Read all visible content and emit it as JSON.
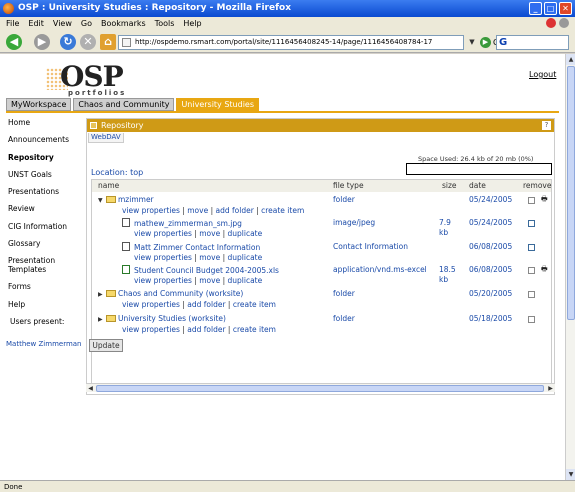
{
  "window": {
    "title": "OSP : University Studies : Repository - Mozilla Firefox"
  },
  "menu": [
    "File",
    "Edit",
    "View",
    "Go",
    "Bookmarks",
    "Tools",
    "Help"
  ],
  "toolbar": {
    "url": "http://ospdemo.rsmart.com/portal/site/1116456408245-14/page/1116456408784-17",
    "go_label": "Go",
    "search_value": "G"
  },
  "header": {
    "logo": "OSP",
    "logo_sub": "portfolios",
    "logout": "Logout"
  },
  "tabs": [
    {
      "label": "MyWorkspace"
    },
    {
      "label": "Chaos and Community"
    },
    {
      "label": "University Studies",
      "active": true
    }
  ],
  "sidebar": {
    "items": [
      {
        "label": "Home"
      },
      {
        "label": "Announcements"
      },
      {
        "label": "Repository",
        "current": true
      },
      {
        "label": "UNST Goals"
      },
      {
        "label": "Presentations"
      },
      {
        "label": "Review"
      },
      {
        "label": "CIG Information"
      },
      {
        "label": "Glossary"
      },
      {
        "label": "Presentation Templates"
      },
      {
        "label": "Forms"
      },
      {
        "label": "Help"
      }
    ],
    "users_present": "Users present:",
    "user": "Matthew Zimmerman"
  },
  "portlet": {
    "title": "Repository",
    "webdav": "WebDAV",
    "space_used": "Space Used: 26.4 kb of 20 mb  (0%)",
    "location_label": "Location:",
    "location_value": "top",
    "columns": {
      "name": "name",
      "type": "file type",
      "size": "size",
      "date": "date",
      "remove": "remove"
    },
    "rows": [
      {
        "name": "mzimmer",
        "actions": [
          "view properties",
          "move",
          "add folder",
          "create item"
        ],
        "type": "folder",
        "size": "",
        "date": "05/24/2005"
      },
      {
        "name": "mathew_zimmerman_sm.jpg",
        "actions": [
          "view properties",
          "move",
          "duplicate"
        ],
        "type": "image/jpeg",
        "size": "7.9 kb",
        "date": "05/24/2005"
      },
      {
        "name": "Matt Zimmer Contact Information",
        "actions": [
          "view properties",
          "move",
          "duplicate"
        ],
        "type": "Contact Information",
        "size": "",
        "date": "06/08/2005"
      },
      {
        "name": "Student Council Budget 2004-2005.xls",
        "actions": [
          "view properties",
          "move",
          "duplicate"
        ],
        "type": "application/vnd.ms-excel",
        "size": "18.5 kb",
        "date": "06/08/2005"
      },
      {
        "name": "Chaos and Community (worksite)",
        "actions": [
          "view properties",
          "add folder",
          "create item"
        ],
        "type": "folder",
        "size": "",
        "date": "05/20/2005"
      },
      {
        "name": "University Studies (worksite)",
        "actions": [
          "view properties",
          "add folder",
          "create item"
        ],
        "type": "folder",
        "size": "",
        "date": "05/18/2005"
      }
    ],
    "update_label": "Update"
  },
  "status": {
    "text": "Done"
  }
}
